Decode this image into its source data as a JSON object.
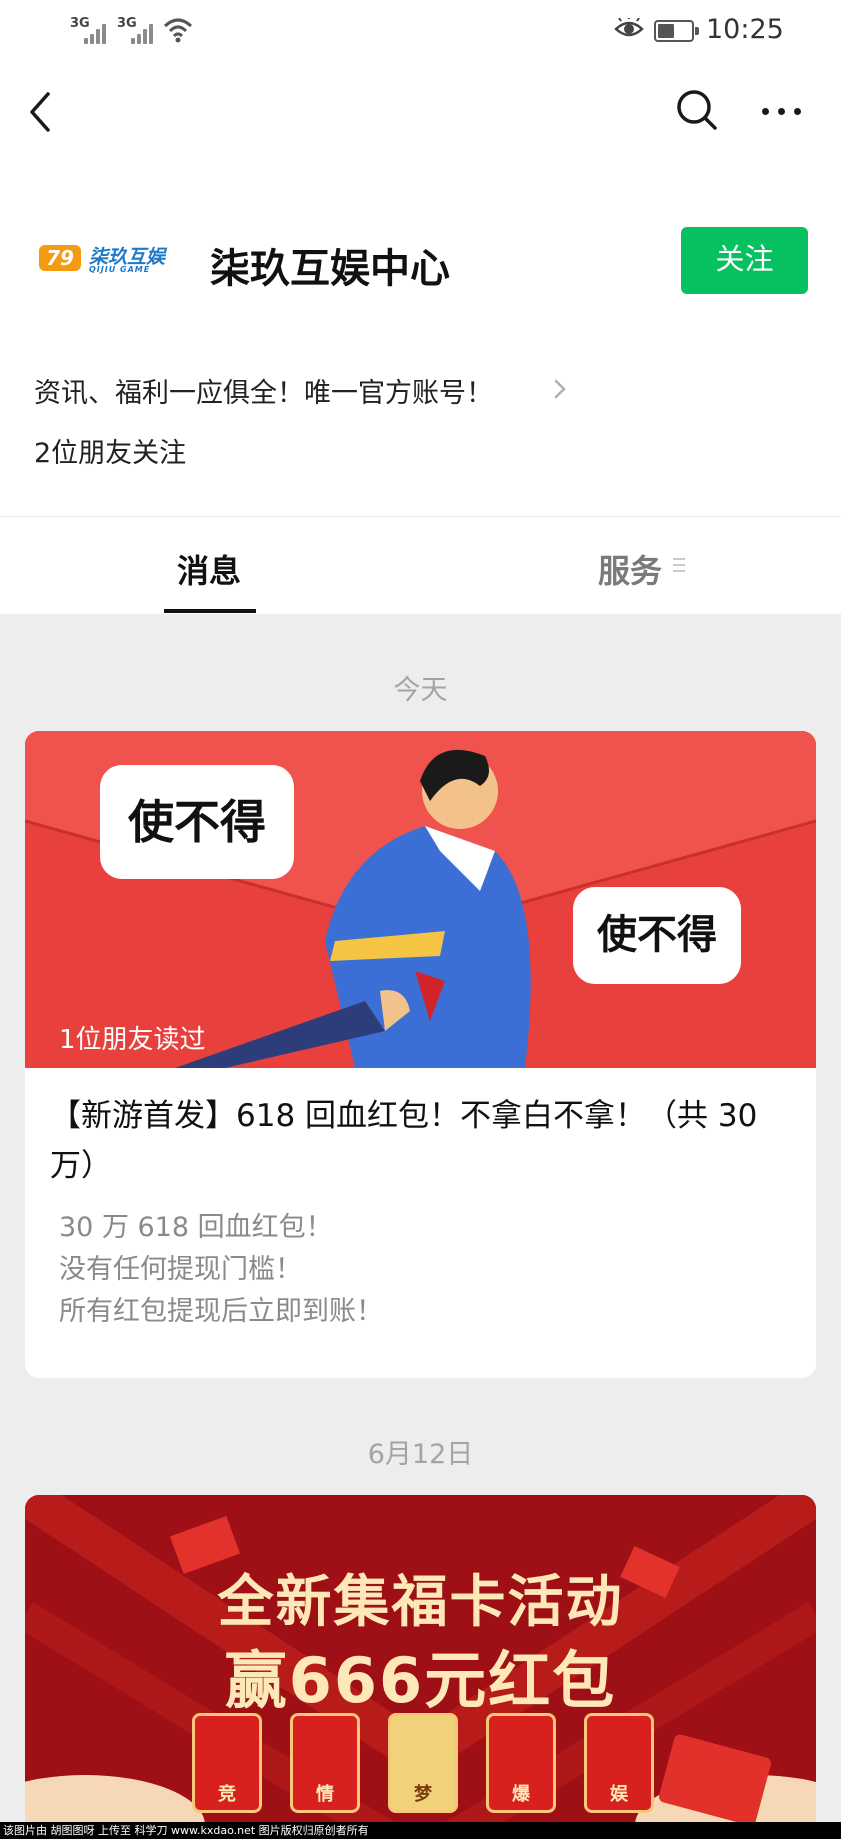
{
  "status_bar": {
    "signal1": "3G",
    "signal2": "3G",
    "time": "10:25",
    "battery_level": 0.5
  },
  "nav": {
    "back_icon": "chevron-left-icon",
    "search_icon": "search-icon",
    "more_icon": "more-horizontal-icon"
  },
  "account": {
    "logo_badge": "79",
    "logo_text": "柒玖互娱",
    "logo_subtext": "QIJIU GAME",
    "name": "柒玖互娱中心",
    "follow_label": "关注",
    "intro": "资讯、福利一应俱全！唯一官方账号！",
    "friends_following": "2位朋友关注"
  },
  "tabs": [
    {
      "label": "消息",
      "active": true
    },
    {
      "label": "服务",
      "active": false
    }
  ],
  "feed": {
    "groups": [
      {
        "date": "今天",
        "article": {
          "cover_bubble_1": "使不得",
          "cover_bubble_2": "使不得",
          "read_by": "1位朋友读过",
          "title": "【新游首发】618 回血红包！不拿白不拿！（共 30 万）",
          "digest": [
            "30 万 618 回血红包！",
            "没有任何提现门槛！",
            "所有红包提现后立即到账！"
          ]
        }
      },
      {
        "date": "6月12日",
        "article": {
          "banner_line1": "全新集福卡活动",
          "banner_line2": "赢666元红包",
          "cards": [
            "竞",
            "情",
            "梦",
            "爆",
            "娱"
          ]
        }
      }
    ]
  },
  "watermark": "该图片由 胡图图呀 上传至 科学刀 www.kxdao.net 图片版权归原创者所有",
  "colors": {
    "accent_green": "#07c160",
    "cover_red": "#e63a3a",
    "banner_red": "#a51217",
    "feed_bg": "#ededed"
  }
}
